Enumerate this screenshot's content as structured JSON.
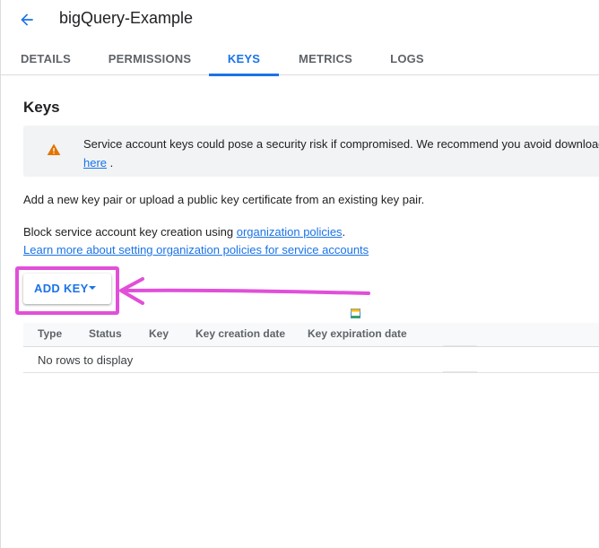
{
  "header": {
    "title": "bigQuery-Example"
  },
  "tabs": [
    {
      "label": "DETAILS",
      "active": false
    },
    {
      "label": "PERMISSIONS",
      "active": false
    },
    {
      "label": "KEYS",
      "active": true
    },
    {
      "label": "METRICS",
      "active": false
    },
    {
      "label": "LOGS",
      "active": false
    }
  ],
  "keys_section": {
    "title": "Keys",
    "alert": {
      "text": "Service account keys could pose a security risk if compromised. We recommend you avoid download",
      "link_text": "here",
      "suffix": "."
    },
    "intro": "Add a new key pair or upload a public key certificate from an existing key pair.",
    "block_text": "Block service account key creation using",
    "org_policies_link": "organization policies",
    "block_suffix": ".",
    "learn_more_link": "Learn more about setting organization policies for service accounts",
    "add_key_label": "ADD KEY"
  },
  "table": {
    "columns": [
      "Type",
      "Status",
      "Key",
      "Key creation date",
      "Key expiration date"
    ],
    "empty_message": "No rows to display"
  },
  "colors": {
    "accent": "#1a73e8",
    "warning": "#e37400",
    "annotation": "#e14fd9"
  },
  "icons": {
    "back": "arrow-back-icon",
    "warning": "warning-icon",
    "dropdown": "caret-down-icon"
  }
}
